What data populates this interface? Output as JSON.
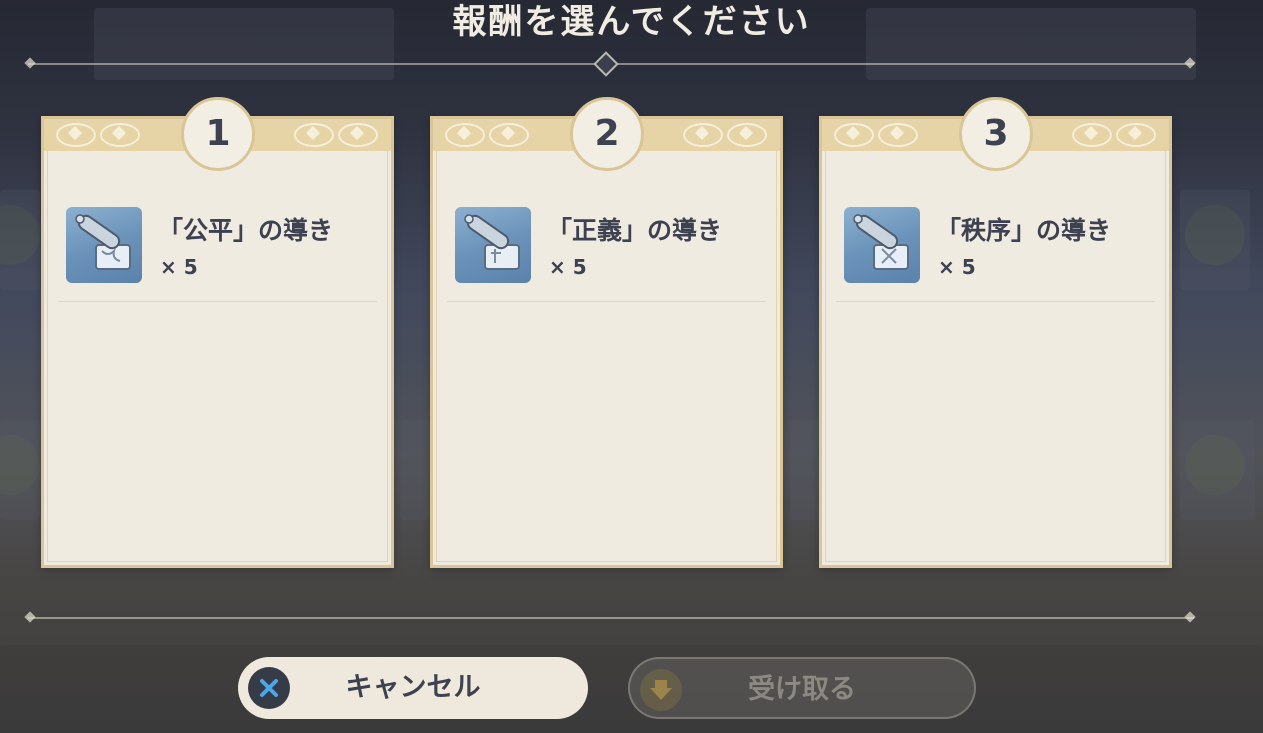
{
  "dialog": {
    "title": "報酬を選んでください"
  },
  "rewards": [
    {
      "number": "1",
      "item_name": "「公平」の導き",
      "quantity": "× 5",
      "icon": "scroll-icon"
    },
    {
      "number": "2",
      "item_name": "「正義」の導き",
      "quantity": "× 5",
      "icon": "scroll-icon"
    },
    {
      "number": "3",
      "item_name": "「秩序」の導き",
      "quantity": "× 5",
      "icon": "scroll-icon"
    }
  ],
  "buttons": {
    "cancel_label": "キャンセル",
    "cancel_icon": "close-x-icon",
    "receive_label": "受け取る",
    "receive_icon": "download-arrow-icon"
  },
  "colors": {
    "card_background": "#f0ebe1",
    "card_border": "#d9c596",
    "text_dark": "#3d4150",
    "cancel_icon_accent": "#4aa8e8",
    "receive_icon_accent": "#c8a24a"
  }
}
